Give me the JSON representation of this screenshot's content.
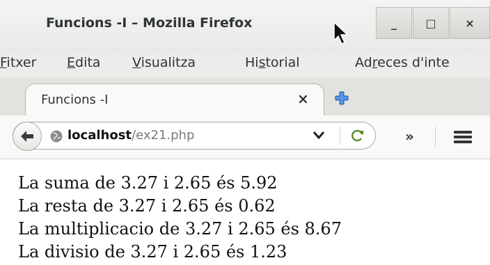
{
  "window": {
    "title": "Funcions -I – Mozilla Firefox",
    "minimize_label": "_",
    "maximize_label": "□",
    "close_label": "×"
  },
  "menubar": {
    "items": [
      {
        "mnemonic": "F",
        "rest": "itxer"
      },
      {
        "mnemonic": "E",
        "rest": "dita"
      },
      {
        "mnemonic": "V",
        "rest": "isualitza"
      },
      {
        "pre": "Hi",
        "mnemonic": "s",
        "rest": "torial"
      },
      {
        "pre": "Ad",
        "mnemonic": "r",
        "rest": "eces d'inte"
      }
    ]
  },
  "tabs": [
    {
      "label": "Funcions -I",
      "close": "×"
    }
  ],
  "navbar": {
    "url_host": "localhost",
    "url_path": "/ex21.php",
    "overflow": "»"
  },
  "content": {
    "lines": [
      "La suma de 3.27 i 2.65 és 5.92",
      "La resta de 3.27 i 2.65 és 0.62",
      "La multiplicacio de 3.27 i 2.65 és 8.67",
      "La divisio de 3.27 i 2.65 és 1.23"
    ]
  },
  "colors": {
    "accent_newtab": "#3f7ed6",
    "reload_green": "#5a8a2e"
  }
}
